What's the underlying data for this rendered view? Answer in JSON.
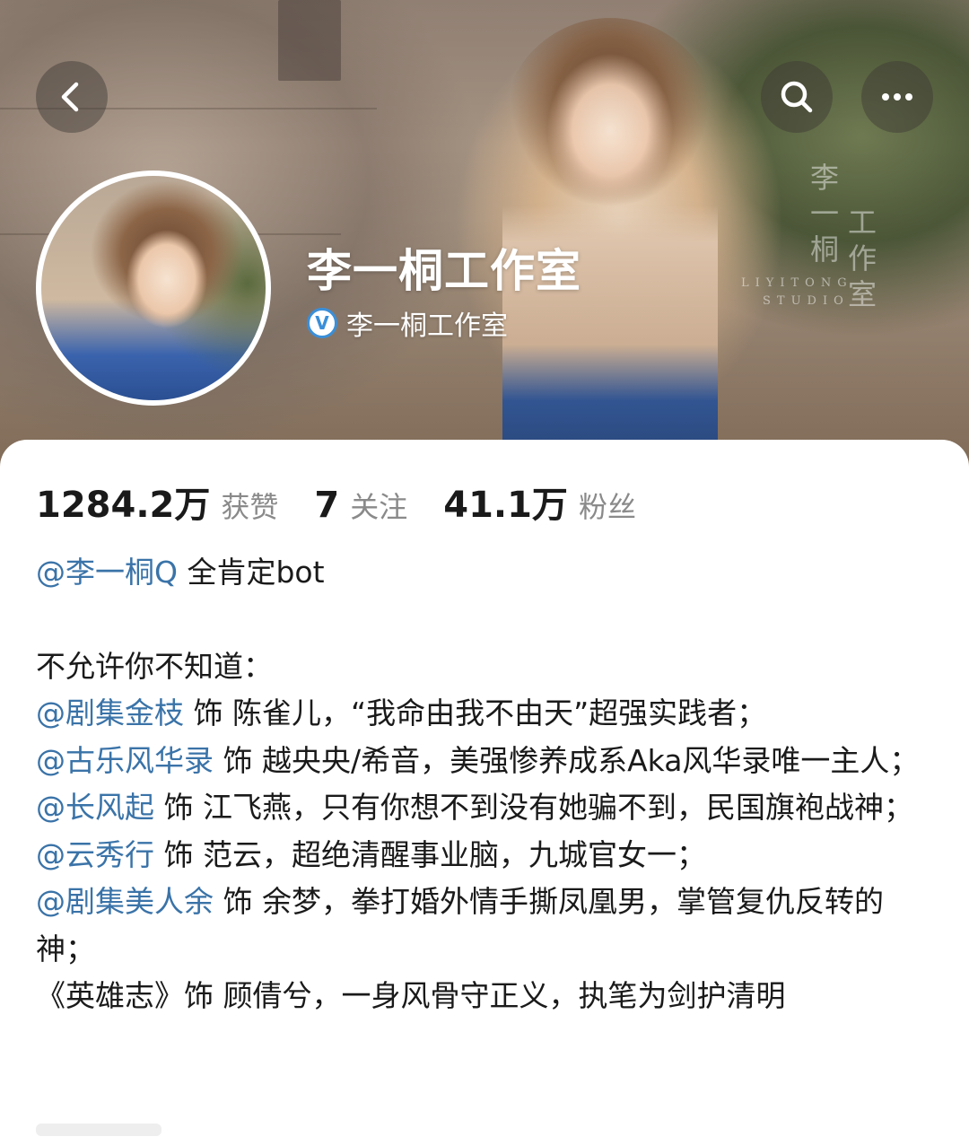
{
  "header": {
    "watermark": {
      "col1": [
        "李",
        "一",
        "桐"
      ],
      "col2": [
        "工",
        "作",
        "室"
      ],
      "english": [
        "LIYITONG",
        "STUDIO"
      ]
    },
    "icons": {
      "back": "chevron-left-icon",
      "search": "search-icon",
      "more": "more-dots-icon"
    }
  },
  "profile": {
    "name": "李一桐工作室",
    "verified_label": "李一桐工作室",
    "verified_badge": "V",
    "badge_color": "#3a8fd9"
  },
  "stats": [
    {
      "value": "1284.2万",
      "label": "获赞"
    },
    {
      "value": "7",
      "label": "关注"
    },
    {
      "value": "41.1万",
      "label": "粉丝"
    }
  ],
  "bio": {
    "line1": {
      "mention": "@李一桐Q",
      "text": " 全肯定bot"
    },
    "intro": "不允许你不知道：",
    "items": [
      {
        "mention": "@剧集金枝",
        "text": " 饰 陈雀儿，“我命由我不由天”超强实践者；"
      },
      {
        "mention": "@古乐风华录",
        "text": " 饰 越央央/希音，美强惨养成系Aka风华录唯一主人；"
      },
      {
        "mention": "@长风起",
        "text": " 饰 江飞燕，只有你想不到没有她骗不到，民国旗袍战神；"
      },
      {
        "mention": "@云秀行",
        "text": " 饰 范云，超绝清醒事业脑，九城官女一；"
      },
      {
        "mention": "@剧集美人余",
        "text": " 饰 余梦，拳打婚外情手撕凤凰男，掌管复仇反转的神；"
      }
    ],
    "last_line": "《英雄志》饰 顾倩兮，一身风骨守正义，执笔为剑护清明"
  },
  "colors": {
    "mention": "#3a73a8",
    "text": "#1a1a1a",
    "muted": "#8a8a8a"
  }
}
